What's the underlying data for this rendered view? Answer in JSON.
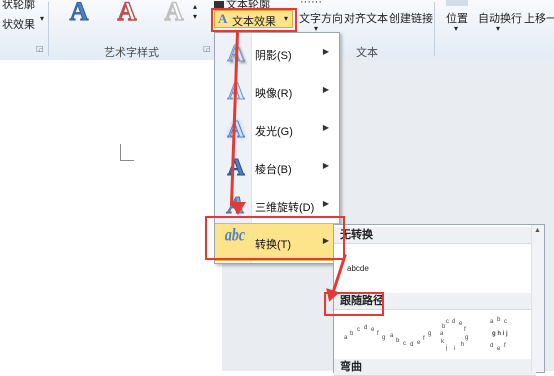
{
  "ribbon": {
    "left_items": [
      "状轮廓",
      "状效果"
    ],
    "group_wordart_styles": "艺术字样式",
    "group_text": "文本",
    "text_outline_label": "文本轮廓",
    "text_effects_button": "文本效果",
    "text_direction": "文字方向",
    "align_text": "对齐文本",
    "create_link": "创建链接",
    "position": "位置",
    "auto_wrap": "自动换行",
    "bring_forward": "上移一"
  },
  "effects_menu": {
    "items": [
      {
        "label": "阴影(S)",
        "icon": "shadow-a-icon"
      },
      {
        "label": "映像(R)",
        "icon": "reflection-a-icon"
      },
      {
        "label": "发光(G)",
        "icon": "glow-a-icon"
      },
      {
        "label": "棱台(B)",
        "icon": "bevel-a-icon"
      },
      {
        "label": "三维旋转(D)",
        "icon": "3d-rotation-a-icon"
      },
      {
        "label": "转换(T)",
        "icon": "transform-abc-icon"
      }
    ]
  },
  "transform_submenu": {
    "no_transform_header": "无转换",
    "no_transform_sample": "abcde",
    "follow_path_header": "跟随路径",
    "warp_header": "弯曲"
  },
  "colors": {
    "accent_highlight": "#fde38a",
    "annotation_red": "#e53935"
  }
}
